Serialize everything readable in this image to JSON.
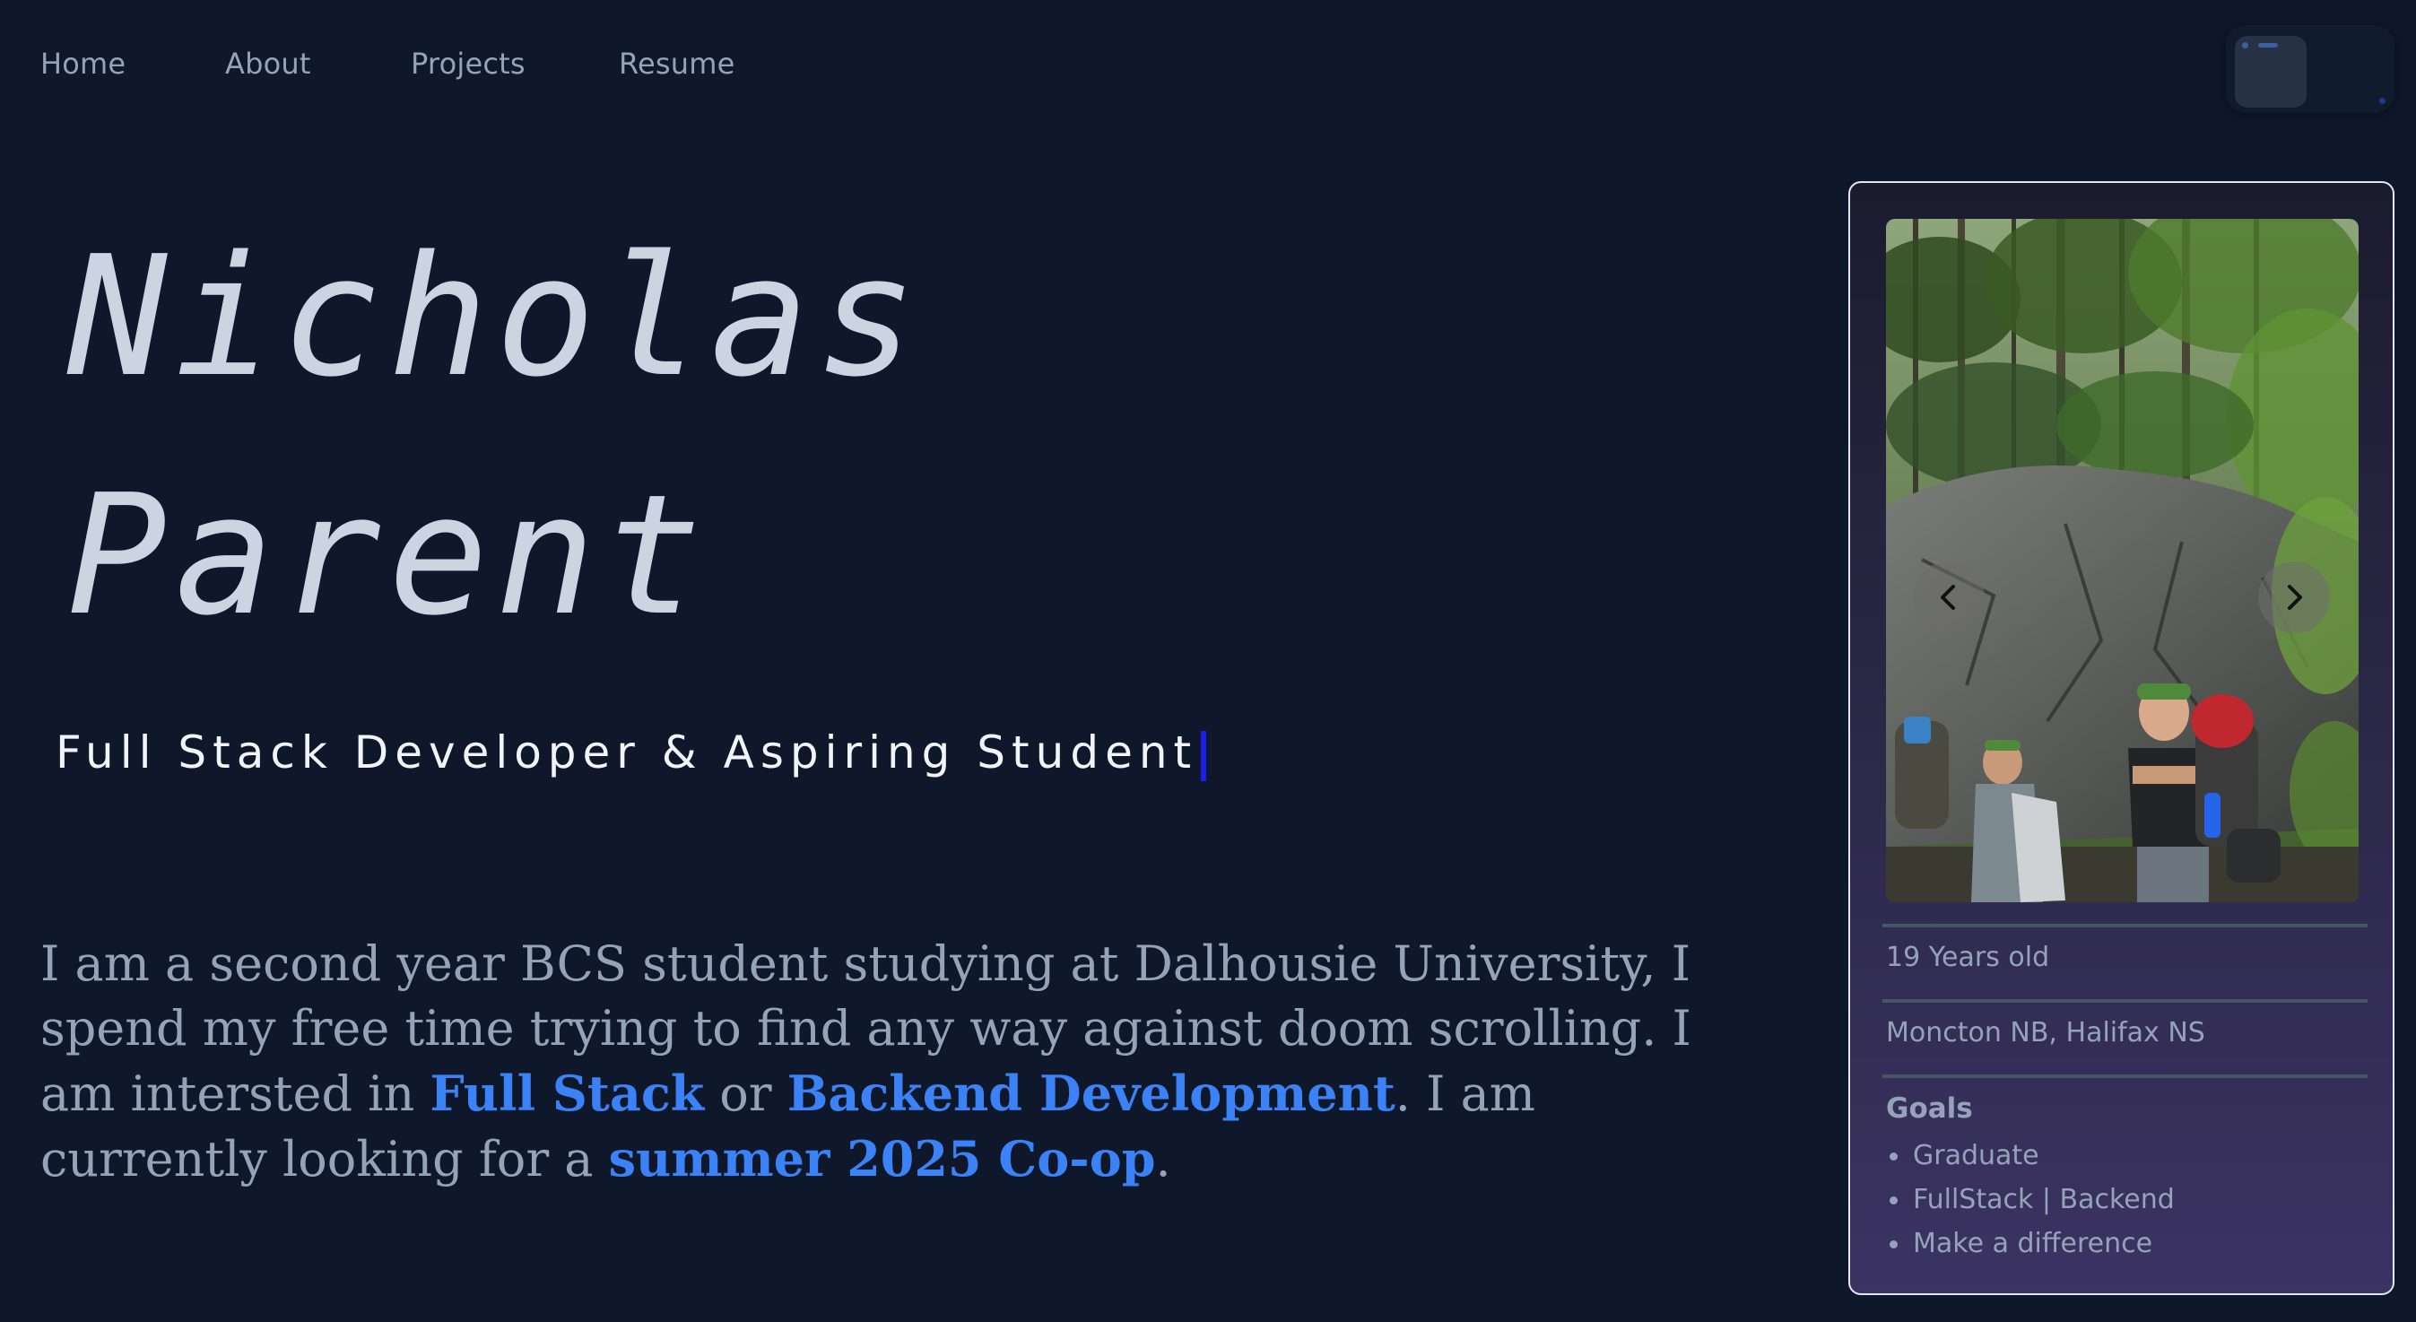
{
  "nav": {
    "items": [
      {
        "label": "Home"
      },
      {
        "label": "About"
      },
      {
        "label": "Projects"
      },
      {
        "label": "Resume"
      }
    ]
  },
  "hero": {
    "first_name": "Nicholas",
    "last_name": "Parent",
    "subtitle": "Full Stack Developer & Aspiring Student"
  },
  "bio": {
    "part1": "I am a second year BCS student studying at Dalhousie University, I spend my free time trying to find any way against doom scrolling. I am intersted in ",
    "highlight1": "Full Stack",
    "part2": " or ",
    "highlight2": "Backend Development",
    "part3": ". I am currently looking for a ",
    "highlight3": "summer 2025 Co-op",
    "part4": "."
  },
  "profile_card": {
    "age": "19 Years old",
    "location": "Moncton NB, Halifax NS",
    "goals_title": "Goals",
    "goals": [
      "Graduate",
      "FullStack | Backend",
      "Make a difference"
    ]
  },
  "colors": {
    "background": "#0f172a",
    "accent": "#3b82f6",
    "muted_text": "#94a3b8",
    "cursor": "#1d1df0"
  },
  "icons": {
    "carousel_prev": "chevron-left-icon",
    "carousel_next": "chevron-right-icon",
    "theme_toggle": "theme-toggle-icon"
  }
}
